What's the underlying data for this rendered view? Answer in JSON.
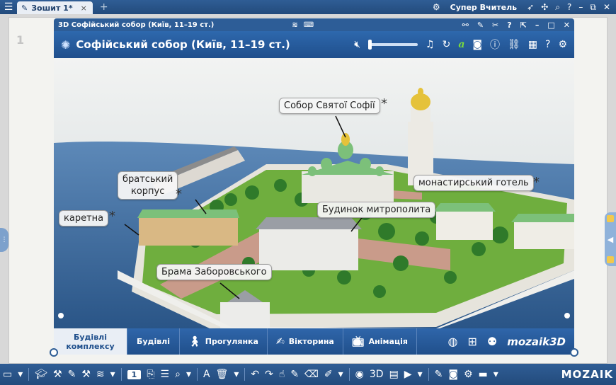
{
  "topbar": {
    "tab_title": "Зошит 1*",
    "tab_close": "×",
    "add_tab": "+",
    "user_name": "Супер Вчитель"
  },
  "workspace": {
    "page_number": "1"
  },
  "window": {
    "titlebar_text": "3D Софійський собор (Київ, 11–19 ст.)",
    "header_title": "Софійський собор (Київ, 11–19 ст.)",
    "volume_level": 0
  },
  "labels": {
    "sobor": "Собор Святої Софії",
    "bratsky_1": "братський",
    "bratsky_2": "корпус",
    "hotel": "монастирський готель",
    "metropolit": "Будинок митрополита",
    "karetna": "каретна",
    "brama": "Брама Заборовського",
    "star": "*"
  },
  "bottom_nav": {
    "tabs": [
      {
        "label_1": "Будівлі",
        "label_2": "комплексу"
      },
      {
        "label": "Будівлі"
      },
      {
        "label": "Прогулянка"
      },
      {
        "label": "Вікторина"
      },
      {
        "label": "Анімація"
      }
    ],
    "brand": "mozaik3D"
  },
  "bottombar": {
    "page_indicator": "1",
    "brand": "MOZAIK"
  },
  "colors": {
    "accent": "#2e68ad",
    "roof_green": "#7cc07a",
    "gold": "#e5c23a"
  }
}
